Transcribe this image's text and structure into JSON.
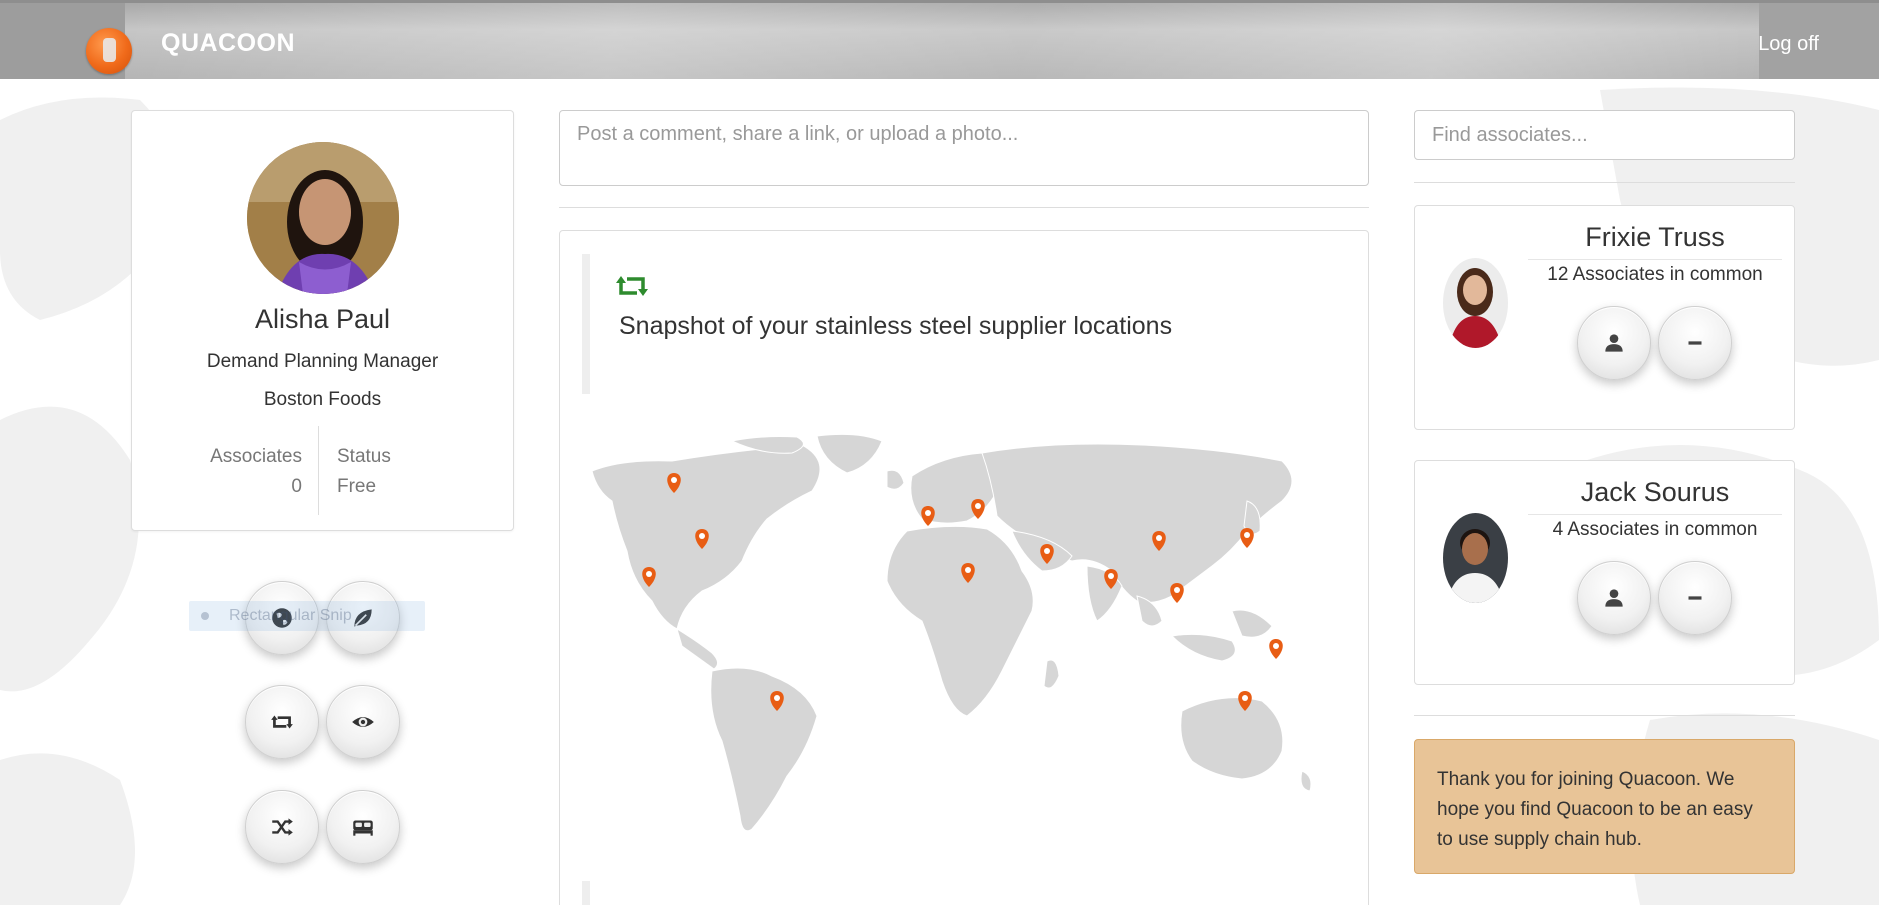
{
  "brand": "QUACOON",
  "nav": {
    "logoff_label": "Log off"
  },
  "profile": {
    "name": "Alisha Paul",
    "title": "Demand Planning Manager",
    "company": "Boston Foods",
    "stats": {
      "associates_label": "Associates",
      "associates_value": "0",
      "status_label": "Status",
      "status_value": "Free"
    }
  },
  "action_buttons": [
    {
      "name": "globe-button",
      "icon": "globe-icon"
    },
    {
      "name": "leaf-button",
      "icon": "leaf-icon"
    },
    {
      "name": "retweet-button",
      "icon": "retweet-icon"
    },
    {
      "name": "eye-button",
      "icon": "eye-icon"
    },
    {
      "name": "shuffle-button",
      "icon": "shuffle-icon"
    },
    {
      "name": "bed-button",
      "icon": "bed-icon"
    }
  ],
  "ghost_tooltip": "Rectangular Snip",
  "composer": {
    "placeholder": "Post a comment, share a link, or upload a photo..."
  },
  "feed": {
    "items": [
      {
        "icon": "retweet-icon",
        "text": "Snapshot of your stainless steel supplier locations"
      }
    ]
  },
  "search": {
    "placeholder": "Find associates..."
  },
  "suggestions": [
    {
      "name": "Frixie Truss",
      "common": "12 Associates in common"
    },
    {
      "name": "Jack Sourus",
      "common": "4 Associates in common"
    }
  ],
  "welcome_message": "Thank you for joining Quacoon. We hope you find Quacoon to be an easy to use supply chain hub.",
  "colors": {
    "accent": "#f06a1a",
    "retweet_green": "#2e8b2e",
    "notice_bg": "#e8c497",
    "map_gray": "#d6d6d6"
  }
}
